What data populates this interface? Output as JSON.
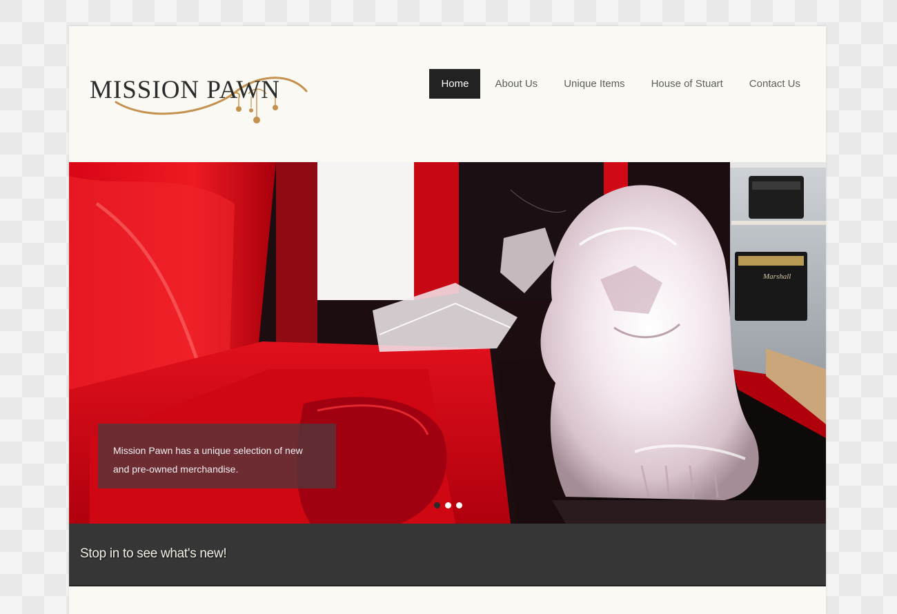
{
  "site": {
    "logo_text": "MISSION PAWN"
  },
  "nav": {
    "items": [
      {
        "label": "Home",
        "active": true
      },
      {
        "label": "About Us",
        "active": false
      },
      {
        "label": "Unique Items",
        "active": false
      },
      {
        "label": "House of Stuart",
        "active": false
      },
      {
        "label": "Contact Us",
        "active": false
      }
    ]
  },
  "slider": {
    "caption": "Mission Pawn has a unique selection of new and pre-owned merchandise.",
    "amp_brand": "Marshall",
    "slides_count": 3,
    "active_slide": 1
  },
  "banner": {
    "text": "Stop in to see what's new!"
  },
  "colors": {
    "accent": "#c4914f",
    "nav_active": "#222222",
    "banner_bg": "#363636"
  }
}
